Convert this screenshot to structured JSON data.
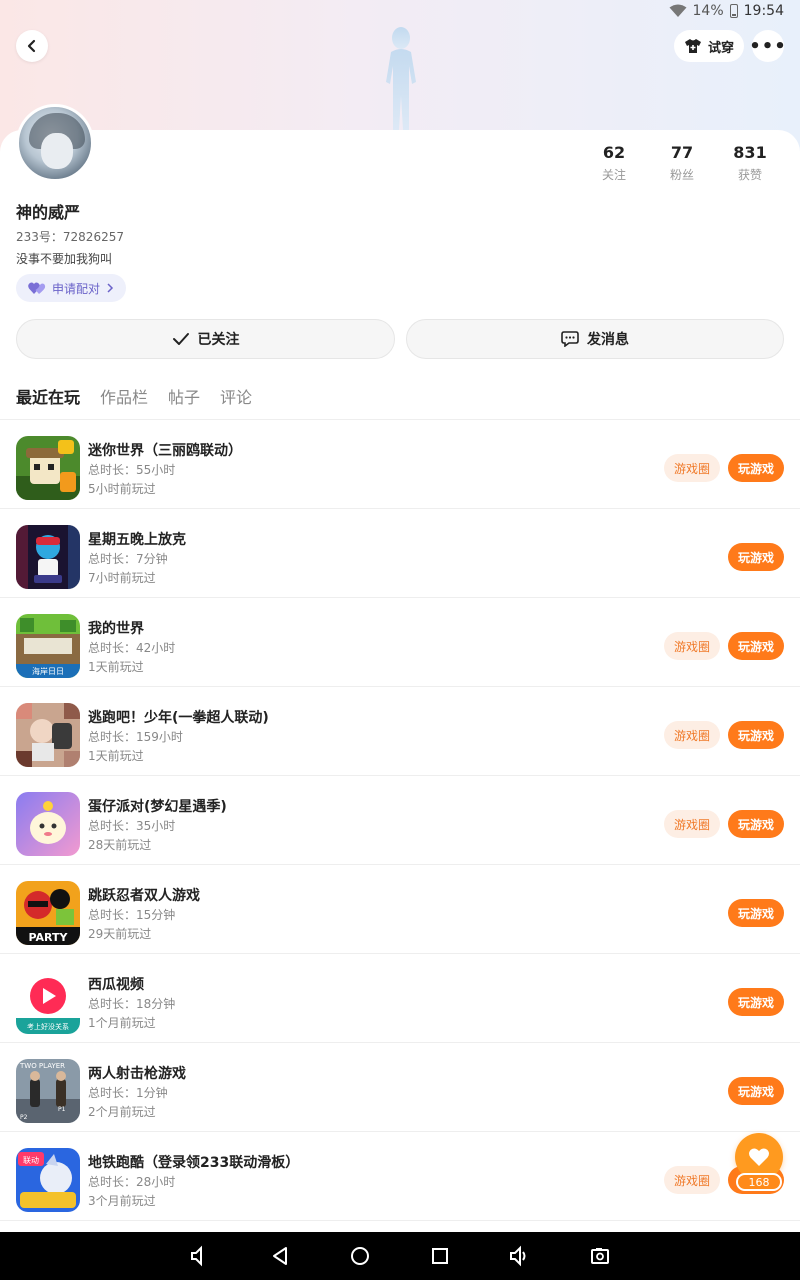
{
  "status_bar": {
    "battery": "14%",
    "time": "19:54",
    "icons": [
      "wifi-icon",
      "battery-icon"
    ]
  },
  "header": {
    "try_on_label": "试穿",
    "more_label": "•••"
  },
  "profile": {
    "username": "神的威严",
    "uid": "233号：72826257",
    "bio": "没事不要加我狗叫",
    "pair_label": "申请配对",
    "stats": [
      {
        "num": "62",
        "label": "关注"
      },
      {
        "num": "77",
        "label": "粉丝"
      },
      {
        "num": "831",
        "label": "获赞"
      }
    ]
  },
  "actions": {
    "followed_label": "已关注",
    "message_label": "发消息"
  },
  "tabs": [
    {
      "label": "最近在玩",
      "active": true
    },
    {
      "label": "作品栏",
      "active": false
    },
    {
      "label": "帖子",
      "active": false
    },
    {
      "label": "评论",
      "active": false
    }
  ],
  "buttons": {
    "circle": "游戏圈",
    "play": "玩游戏"
  },
  "games": [
    {
      "name": "迷你世界（三丽鸥联动）",
      "duration": "总时长：55小时",
      "last_played": "5小时前玩过",
      "has_circle": true
    },
    {
      "name": "星期五晚上放克",
      "duration": "总时长：7分钟",
      "last_played": "7小时前玩过",
      "has_circle": false
    },
    {
      "name": "我的世界",
      "duration": "总时长：42小时",
      "last_played": "1天前玩过",
      "has_circle": true
    },
    {
      "name": "逃跑吧！少年(一拳超人联动)",
      "duration": "总时长：159小时",
      "last_played": "1天前玩过",
      "has_circle": true
    },
    {
      "name": "蛋仔派对(梦幻星遇季)",
      "duration": "总时长：35小时",
      "last_played": "28天前玩过",
      "has_circle": true
    },
    {
      "name": "跳跃忍者双人游戏",
      "duration": "总时长：15分钟",
      "last_played": "29天前玩过",
      "has_circle": false
    },
    {
      "name": "西瓜视频",
      "duration": "总时长：18分钟",
      "last_played": "1个月前玩过",
      "has_circle": false
    },
    {
      "name": "两人射击枪游戏",
      "duration": "总时长：1分钟",
      "last_played": "2个月前玩过",
      "has_circle": false
    },
    {
      "name": "地铁跑酷（登录领233联动滑板）",
      "duration": "总时长：28小时",
      "last_played": "3个月前玩过",
      "has_circle": true
    }
  ],
  "like_fab": {
    "count": "168"
  },
  "icon_text": {
    "party": "PARTY",
    "two_player": "TWO PLAYER",
    "p1": "P1",
    "p2": "P2",
    "mc_banner": "海岸日日",
    "xigua_banner": "考上好没关系",
    "subway_tag": "联动"
  },
  "colors": {
    "accent": "#ff7a1a",
    "circle_bg": "#fdeee4",
    "circle_text": "#f07a2a",
    "pair_text": "#6b63c9"
  }
}
